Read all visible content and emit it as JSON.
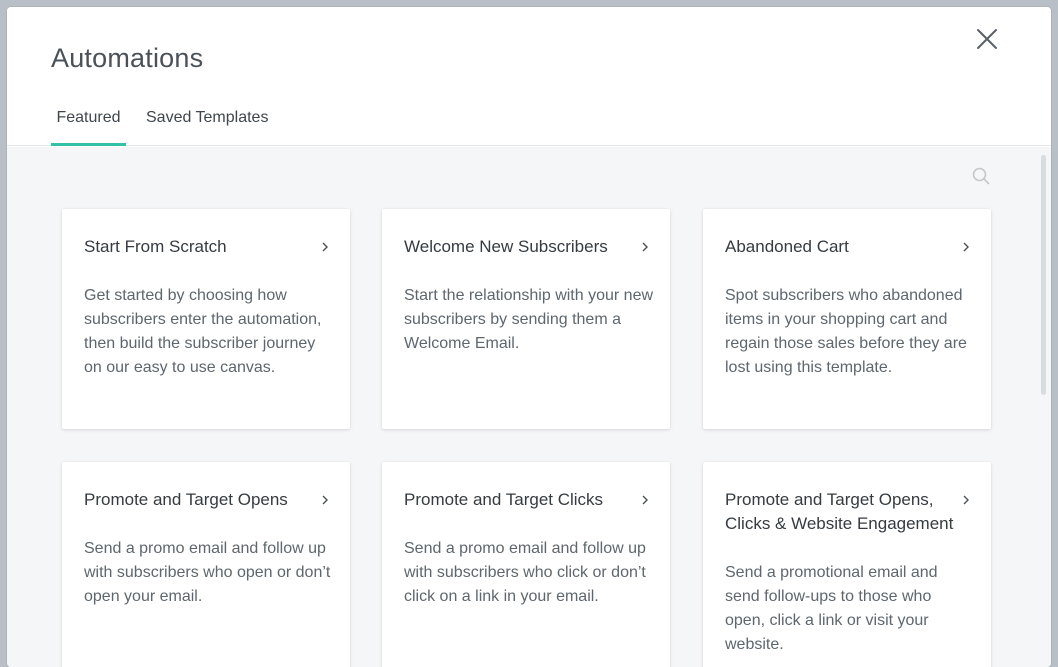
{
  "modal": {
    "title": "Automations",
    "tabs": [
      {
        "label": "Featured",
        "active": true
      },
      {
        "label": "Saved Templates",
        "active": false
      }
    ],
    "accent_color": "#30c1a6",
    "close_icon": "close-icon",
    "search_icon": "search-icon"
  },
  "cards": [
    {
      "title": "Start From Scratch",
      "description": "Get started by choosing how subscribers enter the automation, then build the subscriber journey on our easy to use canvas."
    },
    {
      "title": "Welcome New Subscribers",
      "description": "Start the relationship with your new subscribers by sending them a Welcome Email."
    },
    {
      "title": "Abandoned Cart",
      "description": "Spot subscribers who abandoned items in your shopping cart and regain those sales before they are lost using this template."
    },
    {
      "title": "Promote and Target Opens",
      "description": "Send a promo email and follow up with subscribers who open or don’t open your email."
    },
    {
      "title": "Promote and Target Clicks",
      "description": "Send a promo email and follow up with subscribers who click or don’t click on a link in your email."
    },
    {
      "title": "Promote and Target Opens, Clicks & Website Engagement",
      "description": "Send a promotional email and send follow-ups to those who open, click a link or visit your website."
    }
  ]
}
